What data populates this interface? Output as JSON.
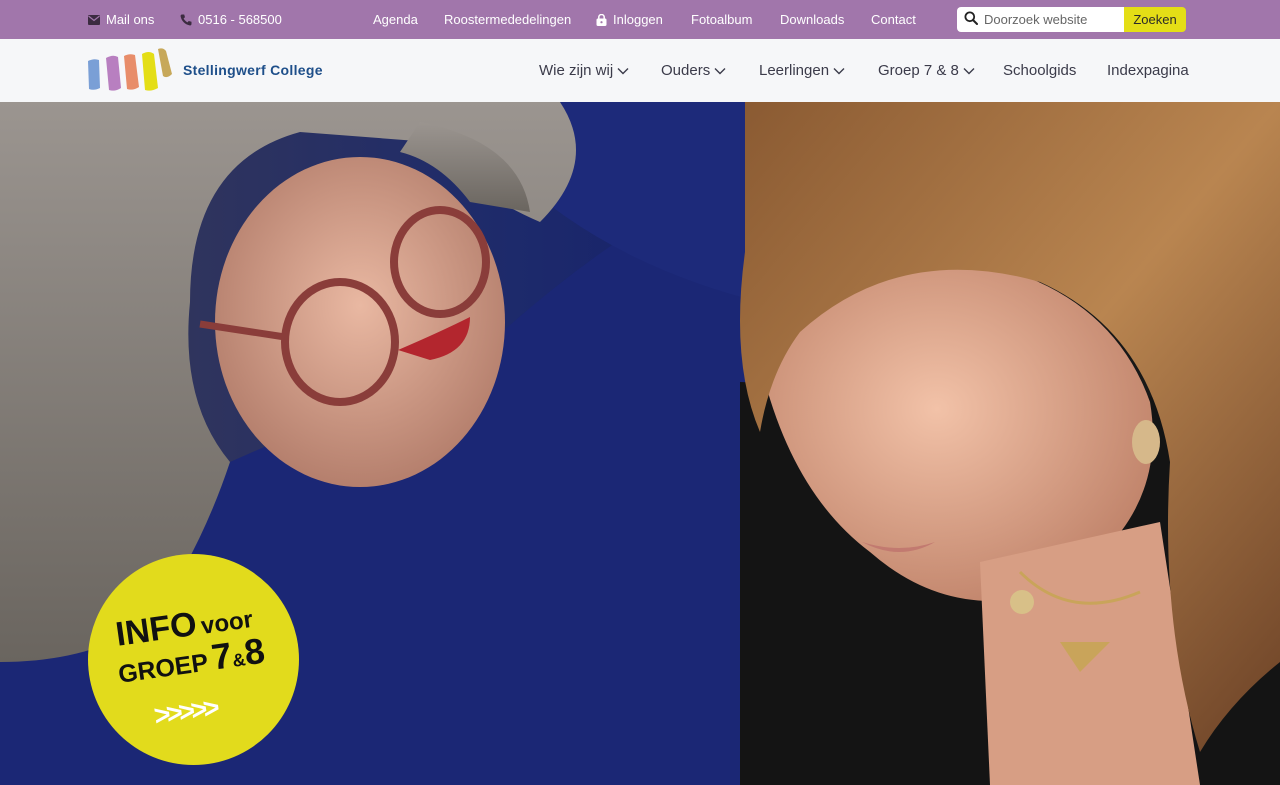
{
  "topbar": {
    "mail_label": "Mail ons",
    "phone_label": "0516 - 568500",
    "links": [
      "Agenda",
      "Roostermededelingen",
      "Inloggen",
      "Fotoalbum",
      "Downloads",
      "Contact"
    ],
    "search_placeholder": "Doorzoek website",
    "search_button": "Zoeken",
    "icons": {
      "mail": "envelope-icon",
      "phone": "phone-icon",
      "login": "lock-icon",
      "search": "search-icon"
    }
  },
  "header": {
    "logo_text": "Stellingwerf College",
    "logo_colors": [
      "#7a9fd6",
      "#b87fc0",
      "#e88d6a",
      "#e4de16",
      "#c7a85a"
    ],
    "nav": [
      {
        "label": "Wie zijn wij",
        "has_dropdown": true
      },
      {
        "label": "Ouders",
        "has_dropdown": true
      },
      {
        "label": "Leerlingen",
        "has_dropdown": true
      },
      {
        "label": "Groep 7 & 8",
        "has_dropdown": true
      },
      {
        "label": "Schoolgids",
        "has_dropdown": false
      },
      {
        "label": "Indexpagina",
        "has_dropdown": false
      }
    ]
  },
  "hero": {
    "badge": {
      "info": "INFO",
      "voor": "voor",
      "groep": "GROEP",
      "seven": "7",
      "amp": "&",
      "eight": "8",
      "arrows": ">>>>>"
    }
  },
  "colors": {
    "topbar": "#a176ab",
    "accent_yellow": "#e4de16",
    "nav_bg": "#f6f7f9",
    "logo_blue": "#1e4f8a"
  }
}
